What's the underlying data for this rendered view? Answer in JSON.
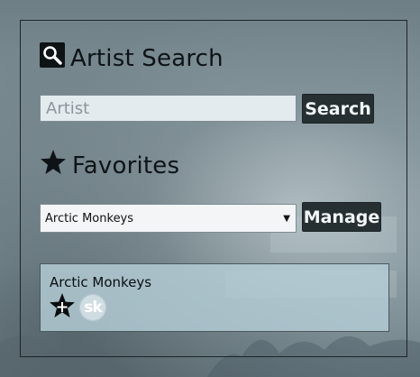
{
  "search": {
    "heading": "Artist Search",
    "icon": "search-icon",
    "input_placeholder": "Artist",
    "input_value": "",
    "button_label": "Search"
  },
  "favorites": {
    "heading": "Favorites",
    "icon": "star-icon",
    "selected_artist": "Arctic Monkeys",
    "manage_label": "Manage"
  },
  "result": {
    "artist_name": "Arctic Monkeys",
    "actions": [
      {
        "icon": "add-favorite-star-icon"
      },
      {
        "icon": "songkick-logo-icon",
        "logo_text": "sk"
      }
    ]
  },
  "colors": {
    "button_bg": "#263033",
    "button_text": "#f3f6f7",
    "result_bg": "#b4cdd7",
    "panel_border": "#1e2428"
  }
}
